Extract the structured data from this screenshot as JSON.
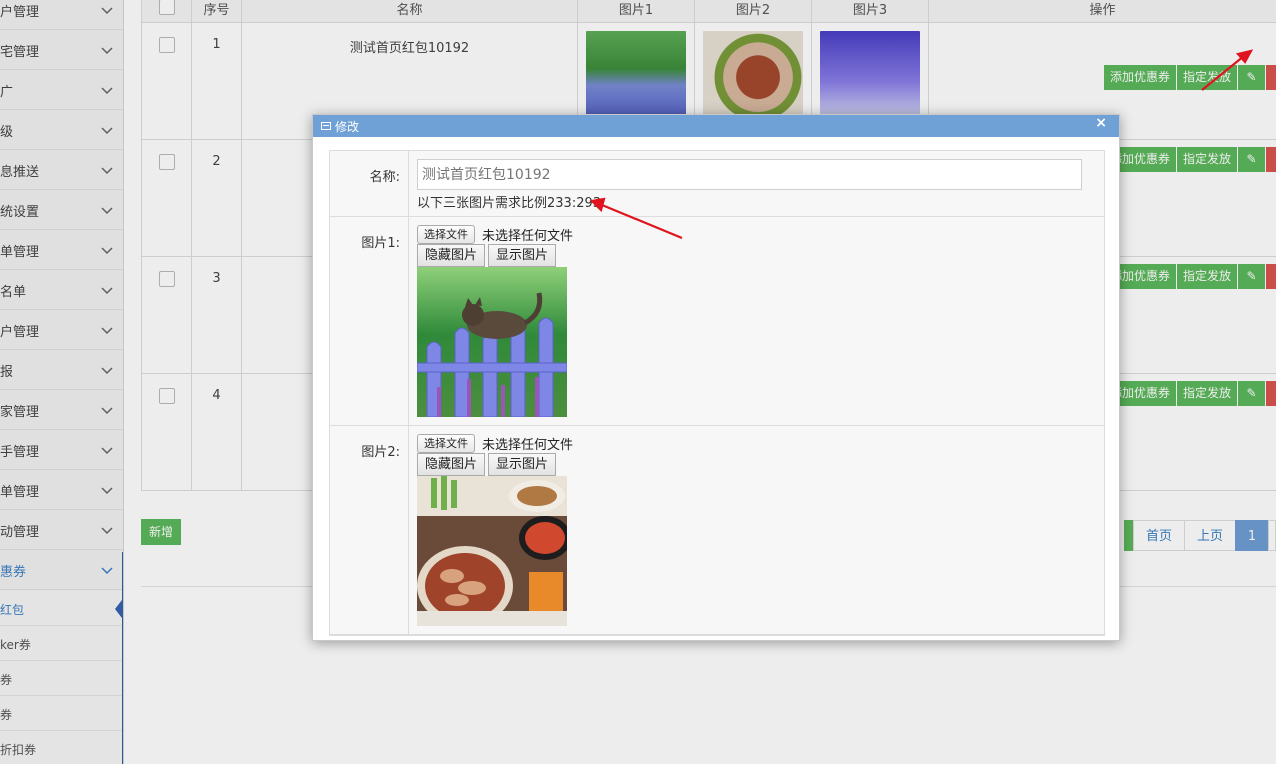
{
  "sidebar": {
    "items": [
      {
        "label": "户管理"
      },
      {
        "label": "宅管理"
      },
      {
        "label": "广"
      },
      {
        "label": "级"
      },
      {
        "label": "息推送"
      },
      {
        "label": "统设置"
      },
      {
        "label": "单管理"
      },
      {
        "label": "名单"
      },
      {
        "label": "户管理"
      },
      {
        "label": "报"
      },
      {
        "label": "家管理"
      },
      {
        "label": "手管理"
      },
      {
        "label": "单管理"
      },
      {
        "label": "动管理"
      },
      {
        "label": "惠券"
      }
    ],
    "subitems": [
      {
        "label": "红包"
      },
      {
        "label": "ker券"
      },
      {
        "label": "券"
      },
      {
        "label": "券"
      },
      {
        "label": "折扣券"
      }
    ]
  },
  "table": {
    "headers": [
      "",
      "序号",
      "名称",
      "图片1",
      "图片2",
      "图片3",
      "操作"
    ],
    "rows": [
      {
        "index": "1",
        "name": "测试首页红包10192"
      },
      {
        "index": "2",
        "name": ""
      },
      {
        "index": "3",
        "name": ""
      },
      {
        "index": "4",
        "name": ""
      }
    ],
    "ops": {
      "add_coupon": "添加优惠券",
      "assign": "指定发放"
    }
  },
  "add_button": "新增",
  "pager": {
    "first": "首页",
    "prev": "上页",
    "current": "1"
  },
  "modal": {
    "title": "修改",
    "close": "×",
    "name_label": "名称:",
    "name_placeholder": "测试首页红包10192",
    "ratio_note": "以下三张图片需求比例233:293",
    "fields": [
      {
        "label": "图片1:",
        "file_button": "选择文件",
        "file_status": "未选择任何文件",
        "hide": "隐藏图片",
        "show": "显示图片"
      },
      {
        "label": "图片2:",
        "file_button": "选择文件",
        "file_status": "未选择任何文件",
        "hide": "隐藏图片",
        "show": "显示图片"
      }
    ]
  },
  "colors": {
    "accent": "#6fa1d6",
    "green": "#5cb85c",
    "red": "#d9534f",
    "arrow": "#e0141e"
  }
}
